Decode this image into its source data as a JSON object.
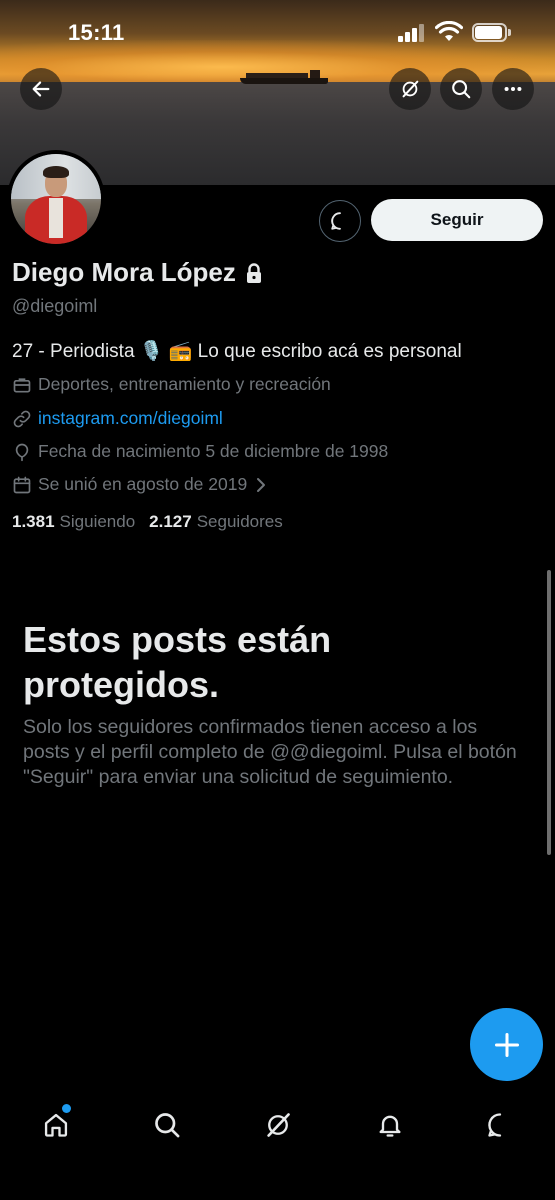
{
  "status_bar": {
    "time": "15:11"
  },
  "profile": {
    "name": "Diego Mora López",
    "handle": "@diegoiml",
    "bio": "27 - Periodista 🎙️ 📻 Lo que escribo acá es personal",
    "category": "Deportes, entrenamiento y recreación",
    "website": "instagram.com/diegoiml",
    "birthdate": "Fecha de nacimiento 5 de diciembre de 1998",
    "joined": "Se unió en agosto de 2019",
    "following_count": "1.381",
    "following_label": "Siguiendo",
    "followers_count": "2.127",
    "followers_label": "Seguidores"
  },
  "actions": {
    "follow_label": "Seguir"
  },
  "protected": {
    "title": "Estos posts están protegidos.",
    "message": "Solo los seguidores confirmados tienen acceso a los posts y el perfil completo de @@diegoiml. Pulsa el botón \"Seguir\" para enviar una solicitud de seguimiento."
  },
  "icons": {
    "back": "arrow-left-icon",
    "grok": "grok-icon",
    "search": "search-icon",
    "more": "more-icon",
    "message": "message-icon",
    "lock": "lock-icon",
    "briefcase": "briefcase-icon",
    "link": "link-icon",
    "location": "balloon-icon",
    "calendar": "calendar-icon",
    "compose": "plus-icon",
    "home": "home-icon",
    "notifications": "bell-icon",
    "messages": "message-icon"
  },
  "colors": {
    "accent": "#1d9bf0",
    "background": "#000000",
    "muted": "#71767b",
    "text": "#e7e9ea"
  }
}
